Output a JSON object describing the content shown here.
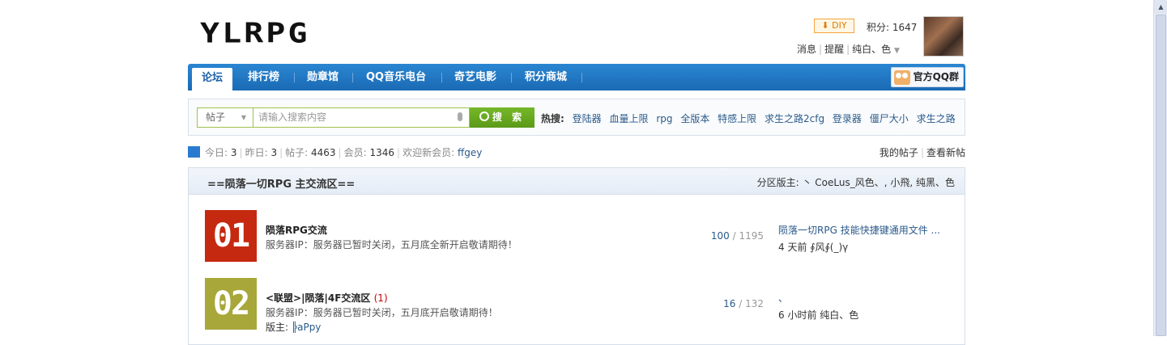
{
  "header": {
    "logo": "YLRPG",
    "diy_label": "DIY",
    "credits": "积分: 1647",
    "links": [
      "消息",
      "提醒",
      "纯白、色"
    ]
  },
  "nav": {
    "items": [
      "论坛",
      "排行榜",
      "勋章馆",
      "QQ音乐电台",
      "奇艺电影",
      "积分商城"
    ],
    "active_index": 0,
    "qq_group": "官方QQ群"
  },
  "search": {
    "type": "帖子",
    "placeholder": "请输入搜索内容",
    "button": "搜 索",
    "hot_label": "热搜:",
    "hot": [
      "登陆器",
      "血量上限",
      "rpg",
      "全版本",
      "特感上限",
      "求生之路2cfg",
      "登录器",
      "僵尸大小",
      "求生之路"
    ]
  },
  "stats": {
    "today_label": "今日:",
    "today": "3",
    "yesterday_label": "昨日:",
    "yesterday": "3",
    "posts_label": "帖子:",
    "posts": "4463",
    "members_label": "会员:",
    "members": "1346",
    "welcome_label": "欢迎新会员:",
    "new_member": "ffgey",
    "my_posts": "我的帖子",
    "new_posts": "查看新帖"
  },
  "section": {
    "title": "==陨落一切RPG 主交流区==",
    "moderators": "分区版主: 丶 CoeLus_风色、, 小飛, 纯黑、色"
  },
  "forums": [
    {
      "badge": "01",
      "badge_color": "#c5290f",
      "name": "陨落RPG交流",
      "today": "",
      "desc": "服务器IP：服务器已暂时关闭，五月底全新开启敬请期待！",
      "mod_label": "",
      "mod": "",
      "threads": "100",
      "posts": "1195",
      "last_title": "陨落一切RPG 技能快捷键通用文件 ...",
      "last_meta": "4 天前 ∮风∮(_)γ"
    },
    {
      "badge": "02",
      "badge_color": "#a8a83a",
      "name": "<联盟>|陨落|4F交流区",
      "today": "(1)",
      "desc": "服务器IP：服务器已暂时关闭，五月底开启敬请期待！",
      "mod_label": "版主:",
      "mod": "╠aPpy",
      "threads": "16",
      "posts": "132",
      "last_title": "、",
      "last_meta": "6 小时前 纯白、色"
    }
  ]
}
